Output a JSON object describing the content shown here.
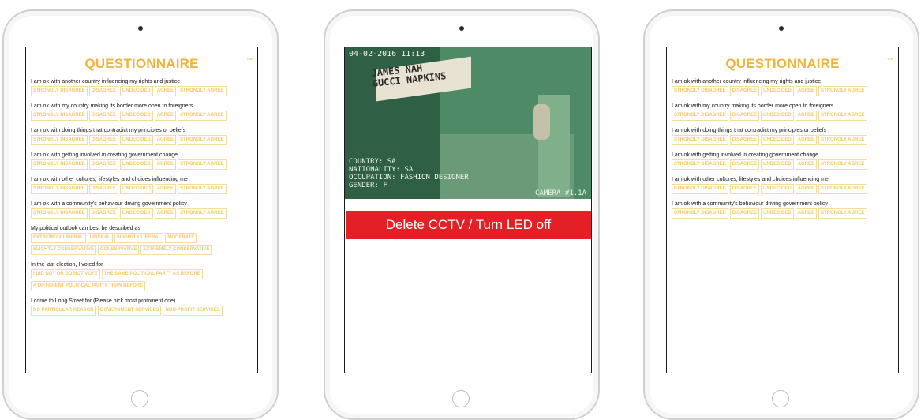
{
  "colors": {
    "accent": "#f0b43a",
    "delete": "#e32026"
  },
  "left": {
    "title": "QUESTIONNAIRE",
    "corner": "Edit",
    "questions": [
      {
        "text": "I am ok with another country influencing my rights and justice",
        "options": [
          "STRONGLY DISAGREE",
          "DISAGREE",
          "UNDECIDED",
          "AGREE",
          "STRONGLY AGREE"
        ]
      },
      {
        "text": "I am ok with my country making its border more open to foreigners",
        "options": [
          "STRONGLY DISAGREE",
          "DISAGREE",
          "UNDECIDED",
          "AGREE",
          "STRONGLY AGREE"
        ]
      },
      {
        "text": "I am ok with doing things that contradict my principles or beliefs",
        "options": [
          "STRONGLY DISAGREE",
          "DISAGREE",
          "UNDECIDED",
          "AGREE",
          "STRONGLY AGREE"
        ]
      },
      {
        "text": "I am ok with getting involved in creating government change",
        "options": [
          "STRONGLY DISAGREE",
          "DISAGREE",
          "UNDECIDED",
          "AGREE",
          "STRONGLY AGREE"
        ]
      },
      {
        "text": "I am ok with other cultures, lifestyles and choices influencing me",
        "options": [
          "STRONGLY DISAGREE",
          "DISAGREE",
          "UNDECIDED",
          "AGREE",
          "STRONGLY AGREE"
        ]
      },
      {
        "text": "I am ok with a community's behaviour driving government policy",
        "options": [
          "STRONGLY DISAGREE",
          "DISAGREE",
          "UNDECIDED",
          "AGREE",
          "STRONGLY AGREE"
        ]
      },
      {
        "text": "My political outlook can best be described as",
        "options": [
          "EXTREMELY LIBERAL",
          "LIBERAL",
          "SLIGHTLY LIBERAL",
          "MODERATE",
          "SLIGHTLY CONSERVATIVE",
          "CONSERVATIVE",
          "EXTREMELY CONSERVATIVE"
        ]
      },
      {
        "text": "In the last election, I voted for",
        "options": [
          "I DID NOT OR DO NOT VOTE",
          "THE SAME POLITICAL PARTY AS BEFORE",
          "A DIFFERENT POLITICAL PARTY THAN BEFORE"
        ]
      },
      {
        "text": "I come to Long Street for (Please pick most prominent one)",
        "options": [
          "NO PARTICULAR REASON",
          "GOVERNMENT SERVICES",
          "NON-PROFIT SERVICES"
        ]
      }
    ]
  },
  "middle": {
    "timestamp": "04-02-2016 11:13",
    "sign_line1": "JAMES  NAH",
    "sign_line2": "GUCCI NAPKINS",
    "country": "COUNTRY: SA",
    "nationality": "NATIONALITY: SA",
    "occupation": "OCCUPATION: FASHION DESIGNER",
    "gender": "GENDER: F",
    "camera": "CAMERA #1.1A",
    "delete_label": "Delete CCTV / Turn LED off"
  },
  "right": {
    "title": "QUESTIONNAIRE",
    "corner": "Edit",
    "questions": [
      {
        "text": "I am ok with another country influencing my rights and justice",
        "options": [
          "STRONGLY DISAGREE",
          "DISAGREE",
          "UNDECIDED",
          "AGREE",
          "STRONGLY AGREE"
        ]
      },
      {
        "text": "I am ok with my country making its border more open to foreigners",
        "options": [
          "STRONGLY DISAGREE",
          "DISAGREE",
          "UNDECIDED",
          "AGREE",
          "STRONGLY AGREE"
        ]
      },
      {
        "text": "I am ok with doing things that contradict my principles or beliefs",
        "options": [
          "STRONGLY DISAGREE",
          "DISAGREE",
          "UNDECIDED",
          "AGREE",
          "STRONGLY AGREE"
        ]
      },
      {
        "text": "I am ok with getting involved in creating government change",
        "options": [
          "STRONGLY DISAGREE",
          "DISAGREE",
          "UNDECIDED",
          "AGREE",
          "STRONGLY AGREE"
        ]
      },
      {
        "text": "I am ok with other cultures, lifestyles and choices influencing me",
        "options": [
          "STRONGLY DISAGREE",
          "DISAGREE",
          "UNDECIDED",
          "AGREE",
          "STRONGLY AGREE"
        ]
      },
      {
        "text": "I am ok with a community's behaviour driving government policy",
        "options": [
          "STRONGLY DISAGREE",
          "DISAGREE",
          "UNDECIDED",
          "AGREE",
          "STRONGLY AGREE"
        ]
      }
    ]
  }
}
